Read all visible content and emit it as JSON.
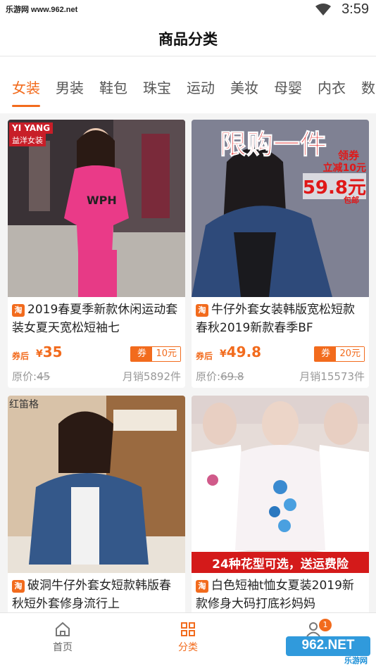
{
  "status_bar": {
    "carrier": "乐游网 www.962.net",
    "time": "3:59"
  },
  "header": {
    "title": "商品分类"
  },
  "tabs": [
    "女装",
    "男装",
    "鞋包",
    "珠宝",
    "运动",
    "美妆",
    "母婴",
    "内衣",
    "数"
  ],
  "active_tab": 0,
  "products": [
    {
      "image_text": {
        "brand": "YI YANG",
        "brand_sub": "益洋女装"
      },
      "source_icon": "淘",
      "name": "2019春夏季新款休闲运动套装女夏天宽松短袖七",
      "after_label": "券后",
      "currency": "¥",
      "price": "35",
      "coupon_label": "券",
      "coupon_amount": "10元",
      "orig_label": "原价:",
      "orig_price": "45",
      "sales": "月销5892件"
    },
    {
      "image_text": {
        "headline": "限购一件",
        "line1": "领券",
        "line2": "立减10元",
        "line3": "59.8元",
        "line4": "包邮"
      },
      "source_icon": "淘",
      "name": "牛仔外套女装韩版宽松短款春秋2019新款春季BF",
      "after_label": "券后",
      "currency": "¥",
      "price": "49.8",
      "coupon_label": "券",
      "coupon_amount": "20元",
      "orig_label": "原价:",
      "orig_price": "69.8",
      "sales": "月销15573件"
    },
    {
      "image_text": {
        "brand": "红笛格"
      },
      "source_icon": "淘",
      "name": "破洞牛仔外套女短款韩版春秋短外套修身流行上"
    },
    {
      "image_text": {
        "banner": "24种花型可选，送运费险"
      },
      "source_icon": "淘",
      "name": "白色短袖t恤女夏装2019新款修身大码打底衫妈妈"
    }
  ],
  "bottom_nav": [
    {
      "label": "首页",
      "icon": "home-icon"
    },
    {
      "label": "分类",
      "icon": "category-icon"
    },
    {
      "label": "",
      "icon": "user-icon",
      "badge": "1"
    }
  ],
  "watermark": {
    "text": "962.NET",
    "sub": "乐游网"
  },
  "colors": {
    "accent": "#f26b1d",
    "background": "#f4f4f4"
  }
}
